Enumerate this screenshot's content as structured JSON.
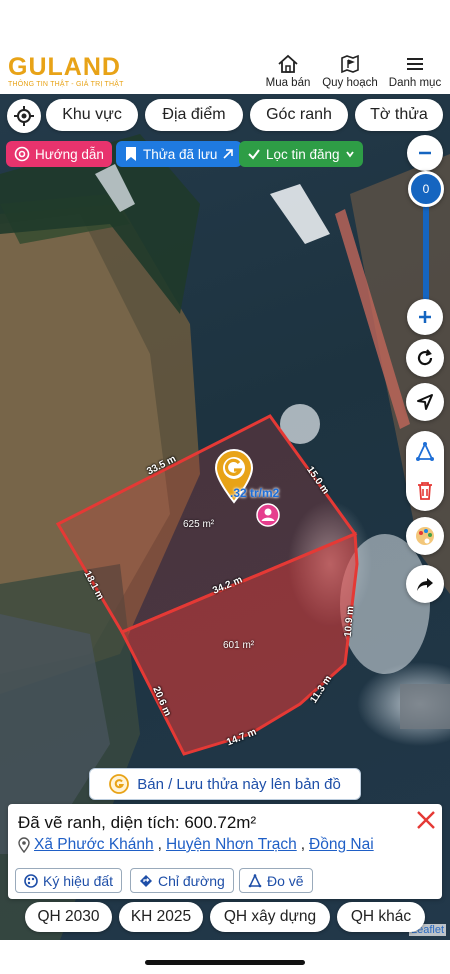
{
  "header": {
    "logo": "GULAND",
    "tagline": "THÔNG TIN THẬT - GIÁ TRỊ THẬT",
    "nav": [
      {
        "label": "Mua bán",
        "icon": "house-icon"
      },
      {
        "label": "Quy hoạch",
        "icon": "map-flag-icon"
      },
      {
        "label": "Danh mục",
        "icon": "menu-icon"
      }
    ]
  },
  "filters": [
    "Khu vực",
    "Địa điểm",
    "Góc ranh",
    "Tờ thửa"
  ],
  "chips": {
    "guide": "Hướng dẫn",
    "saved": "Thửa đã lưu",
    "filter": "Lọc tin đăng"
  },
  "zoom": {
    "value": "0"
  },
  "map": {
    "lengths": [
      "33.5 m",
      "15.0 m",
      "18.1 m",
      "34.2 m",
      "10.9 m",
      "20.6 m",
      "11.3 m",
      "14.7 m"
    ],
    "areas": [
      "625 m²",
      "601 m²"
    ],
    "price": ".32 tr/m2",
    "attribution": "Leaflet"
  },
  "sell_button": "Bán / Lưu thửa này lên bản đồ",
  "info": {
    "title": "Đã vẽ ranh, diện tích: 600.72m²",
    "commune": "Xã Phước Khánh",
    "district": "Huyện Nhơn Trạch",
    "province": "Đồng Nai",
    "tools": [
      "Ký hiệu đất",
      "Chỉ đường",
      "Đo vẽ"
    ]
  },
  "plan_buttons": [
    "QH 2030",
    "KH 2025",
    "QH xây dựng",
    "QH khác"
  ],
  "colors": {
    "accent": "#1565c0",
    "brand": "#e8a317",
    "parcel": "#e53935",
    "guide_chip": "#e8336d"
  }
}
